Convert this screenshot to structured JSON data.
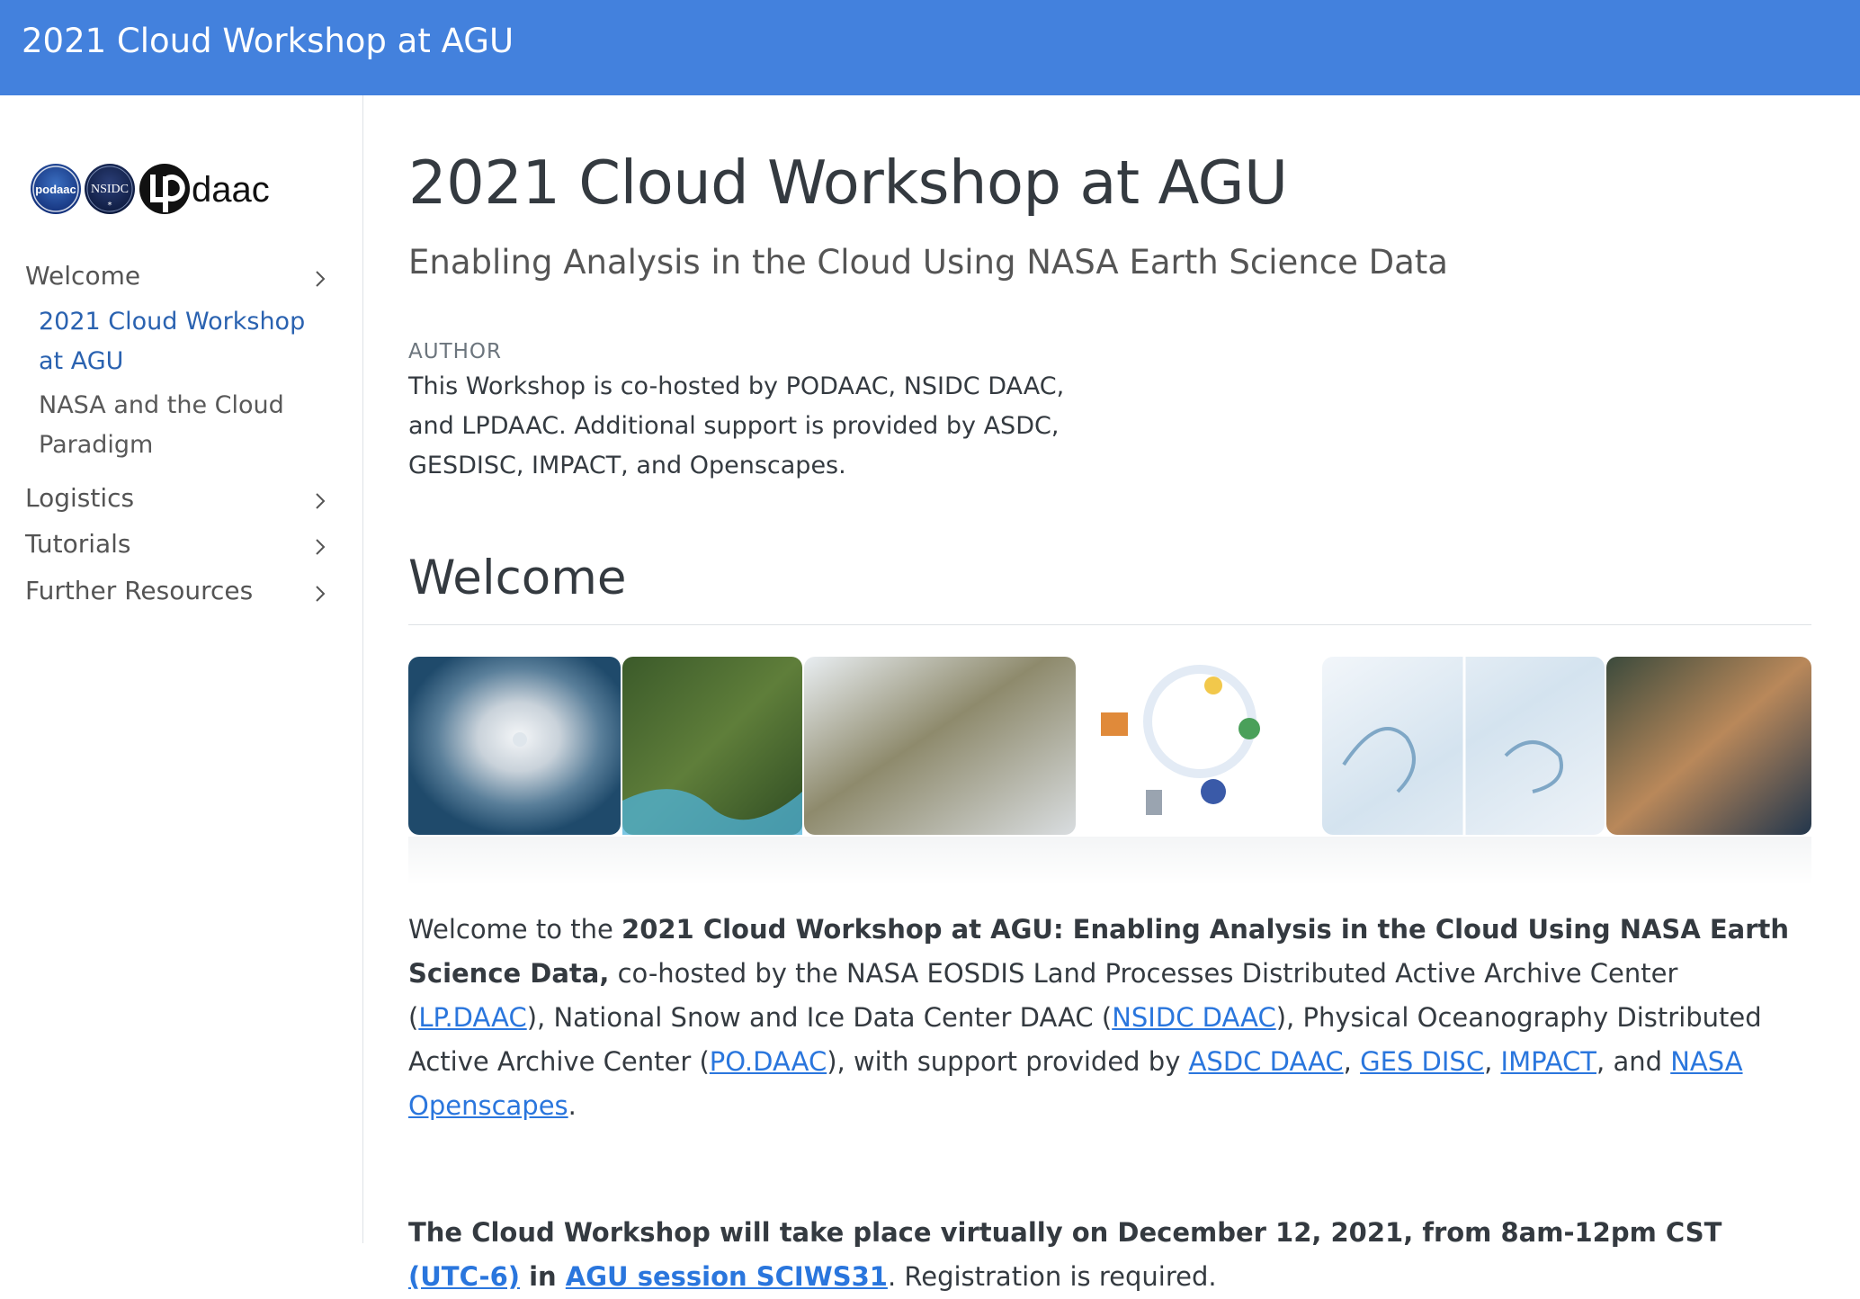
{
  "header": {
    "title": "2021 Cloud Workshop at AGU"
  },
  "sidebar": {
    "logo": {
      "icon": "podaac-nsidc-lpdaac-logos",
      "labels": [
        "podaac",
        "NSIDC",
        "daac"
      ]
    },
    "items": [
      {
        "label": "Welcome",
        "icon": "chevron-right-icon"
      },
      {
        "label": "Logistics",
        "icon": "chevron-right-icon"
      },
      {
        "label": "Tutorials",
        "icon": "chevron-right-icon"
      },
      {
        "label": "Further Resources",
        "icon": "chevron-right-icon"
      }
    ],
    "sub_items": [
      {
        "label": "2021 Cloud Workshop at AGU",
        "active": true
      },
      {
        "label": "NASA and the Cloud Paradigm",
        "active": false
      }
    ],
    "active_color": "#2a62b0"
  },
  "main": {
    "title": "2021 Cloud Workshop at AGU",
    "subtitle": "Enabling Analysis in the Cloud Using NASA Earth Science Data",
    "author_label": "AUTHOR",
    "author_text": "This Workshop is co-hosted by PODAAC, NSIDC DAAC, and LPDAAC. Additional support is provided by ASDC, GESDISC, IMPACT, and Openscapes.",
    "section_heading": "Welcome",
    "welcome": {
      "t1": "Welcome to the ",
      "b1": "2021 Cloud Workshop at AGU: Enabling Analysis in the Cloud Using NASA Earth Science Data,",
      "t2": " co-hosted by the NASA EOSDIS Land Processes Distributed Active Archive Center (",
      "l_lpdaac": "LP.DAAC",
      "t3": "), National Snow and Ice Data Center DAAC (",
      "l_nsidc": "NSIDC DAAC",
      "t4": "), Physical Oceanography Distributed Active Archive Center (",
      "l_podaac": "PO.DAAC",
      "t5": "), with support provided by ",
      "l_asdc": "ASDC DAAC",
      "t6": ", ",
      "l_gesdisc": "GES DISC",
      "t7": ", ",
      "l_impact": "IMPACT",
      "t8": ", and ",
      "l_openscapes": "NASA Openscapes",
      "t9": "."
    },
    "schedule": {
      "b1": "The Cloud Workshop will take place virtually on December 12, 2021, from 8am-12pm CST ",
      "l_utc": "(UTC-6)",
      "b2": " in ",
      "l_session": "AGU session SCIWS31",
      "t1": ". Registration is required."
    },
    "link_color": "#2a76dd"
  }
}
